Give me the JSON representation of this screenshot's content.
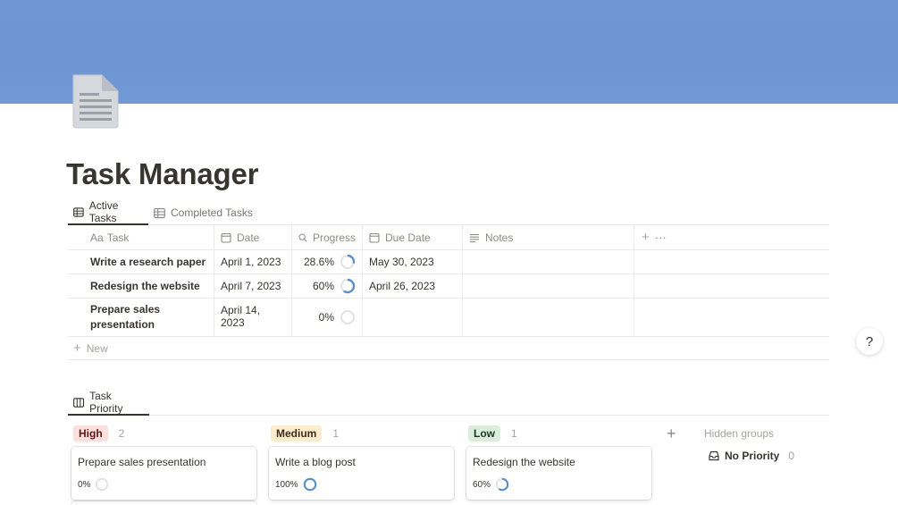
{
  "page": {
    "title": "Task Manager",
    "cover_color": "#6d96d4",
    "icon": "document-icon"
  },
  "table_view": {
    "tabs": [
      {
        "label": "Active Tasks",
        "icon": "table-icon",
        "active": true
      },
      {
        "label": "Completed Tasks",
        "icon": "table-icon",
        "active": false
      }
    ],
    "columns": {
      "task": {
        "prefix": "Aa",
        "label": "Task"
      },
      "date": {
        "label": "Date",
        "icon": "calendar-icon"
      },
      "progress": {
        "label": "Progress",
        "icon": "search-icon"
      },
      "due": {
        "label": "Due Date",
        "icon": "calendar-icon"
      },
      "notes": {
        "label": "Notes",
        "icon": "lines-icon"
      },
      "add": "+",
      "more": "···"
    },
    "rows": [
      {
        "task": "Write a research paper",
        "date": "April 1, 2023",
        "progress": "28.6%",
        "progress_value": 0.286,
        "due": "May 30, 2023",
        "notes": ""
      },
      {
        "task": "Redesign the website",
        "date": "April 7, 2023",
        "progress": "60%",
        "progress_value": 0.6,
        "due": "April 26, 2023",
        "notes": ""
      },
      {
        "task_line1": "Prepare sales",
        "task_line2": "presentation",
        "date": "April 14, 2023",
        "progress": "0%",
        "progress_value": 0,
        "due": "",
        "notes": ""
      }
    ],
    "new_label": "New"
  },
  "help_label": "?",
  "board_view": {
    "tab": {
      "label": "Task Priority",
      "icon": "board-icon"
    },
    "groups": [
      {
        "label": "High",
        "count": "2",
        "pill_bg": "#fde0dd",
        "pill_fg": "#5d1715",
        "card": {
          "title": "Prepare sales presentation",
          "progress": "0%",
          "progress_value": 0
        }
      },
      {
        "label": "Medium",
        "count": "1",
        "pill_bg": "#fbeccb",
        "pill_fg": "#402c1b",
        "card": {
          "title": "Write a blog post",
          "progress": "100%",
          "progress_value": 1
        }
      },
      {
        "label": "Low",
        "count": "1",
        "pill_bg": "#dbeddb",
        "pill_fg": "#1c3829",
        "card": {
          "title": "Redesign the website",
          "progress": "60%",
          "progress_value": 0.6
        }
      }
    ],
    "add_group": "+",
    "hidden_groups_label": "Hidden groups",
    "no_priority": {
      "label": "No Priority",
      "count": "0"
    }
  },
  "colors": {
    "ring_fill": "#5b8fc7",
    "ring_track": "#e3e2e0"
  }
}
